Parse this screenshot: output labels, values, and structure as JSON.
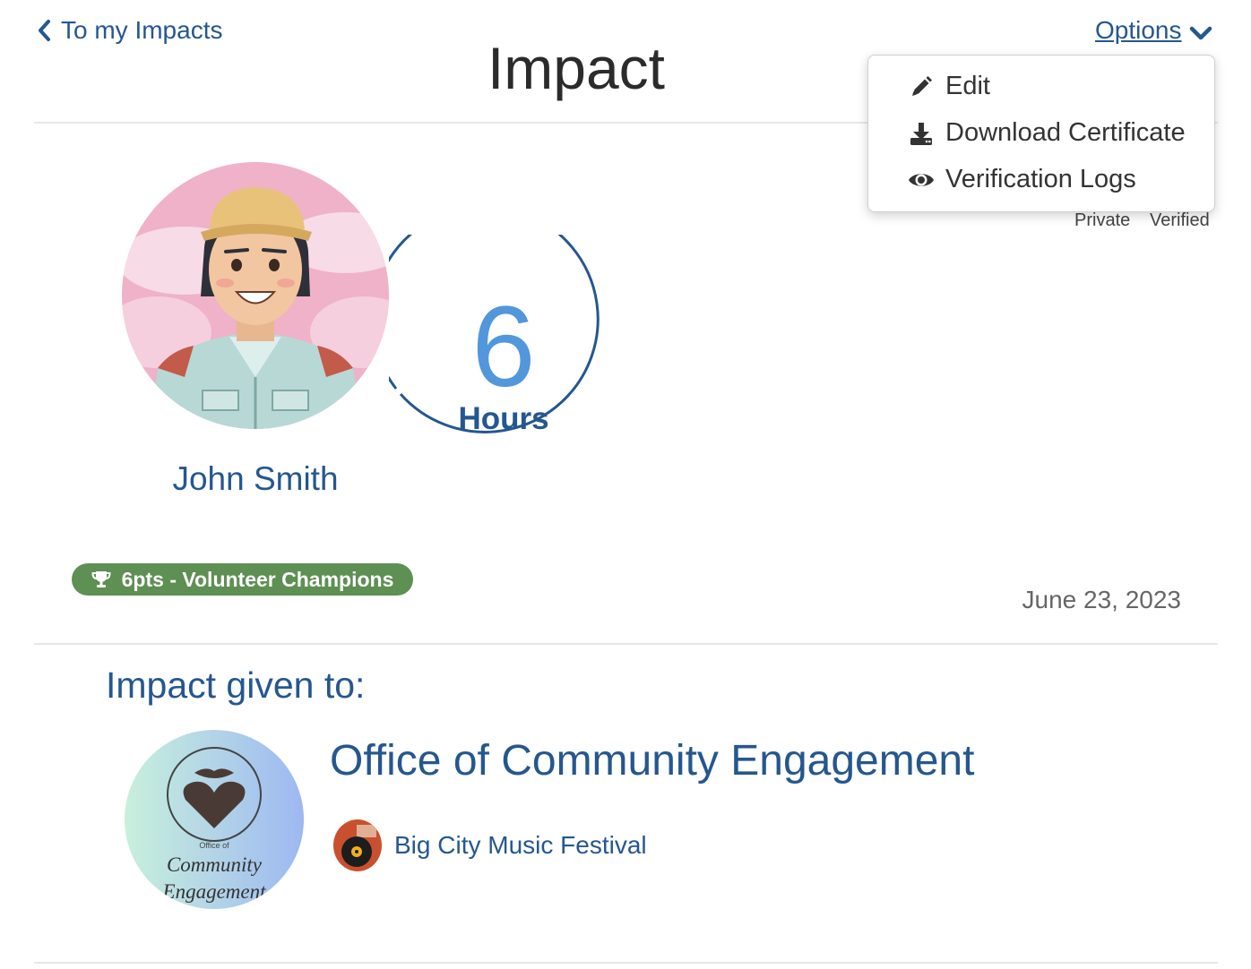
{
  "header": {
    "back_label": "To my Impacts",
    "title": "Impact",
    "options_label": "Options"
  },
  "options_menu": {
    "items": [
      {
        "label": "Edit",
        "icon": "pencil-icon"
      },
      {
        "label": "Download Certificate",
        "icon": "download-icon"
      },
      {
        "label": "Verification Logs",
        "icon": "eye-icon"
      }
    ]
  },
  "tags": {
    "privacy": "Private",
    "verification": "Verified"
  },
  "user": {
    "name": "John Smith"
  },
  "hours": {
    "value": "6",
    "label": "Hours"
  },
  "badge": {
    "label": "6pts - Volunteer Champions",
    "icon": "trophy-icon",
    "color": "#5e8f53"
  },
  "date": "June 23, 2023",
  "impact_given": {
    "heading": "Impact given to:",
    "organization": "Office of Community Engagement",
    "organization_logo_text": {
      "line1": "Office of",
      "line2": "Community",
      "line3": "Engagement"
    },
    "event": "Big City Music Festival"
  },
  "colors": {
    "primary": "#25578f",
    "accent": "#5297dc"
  }
}
